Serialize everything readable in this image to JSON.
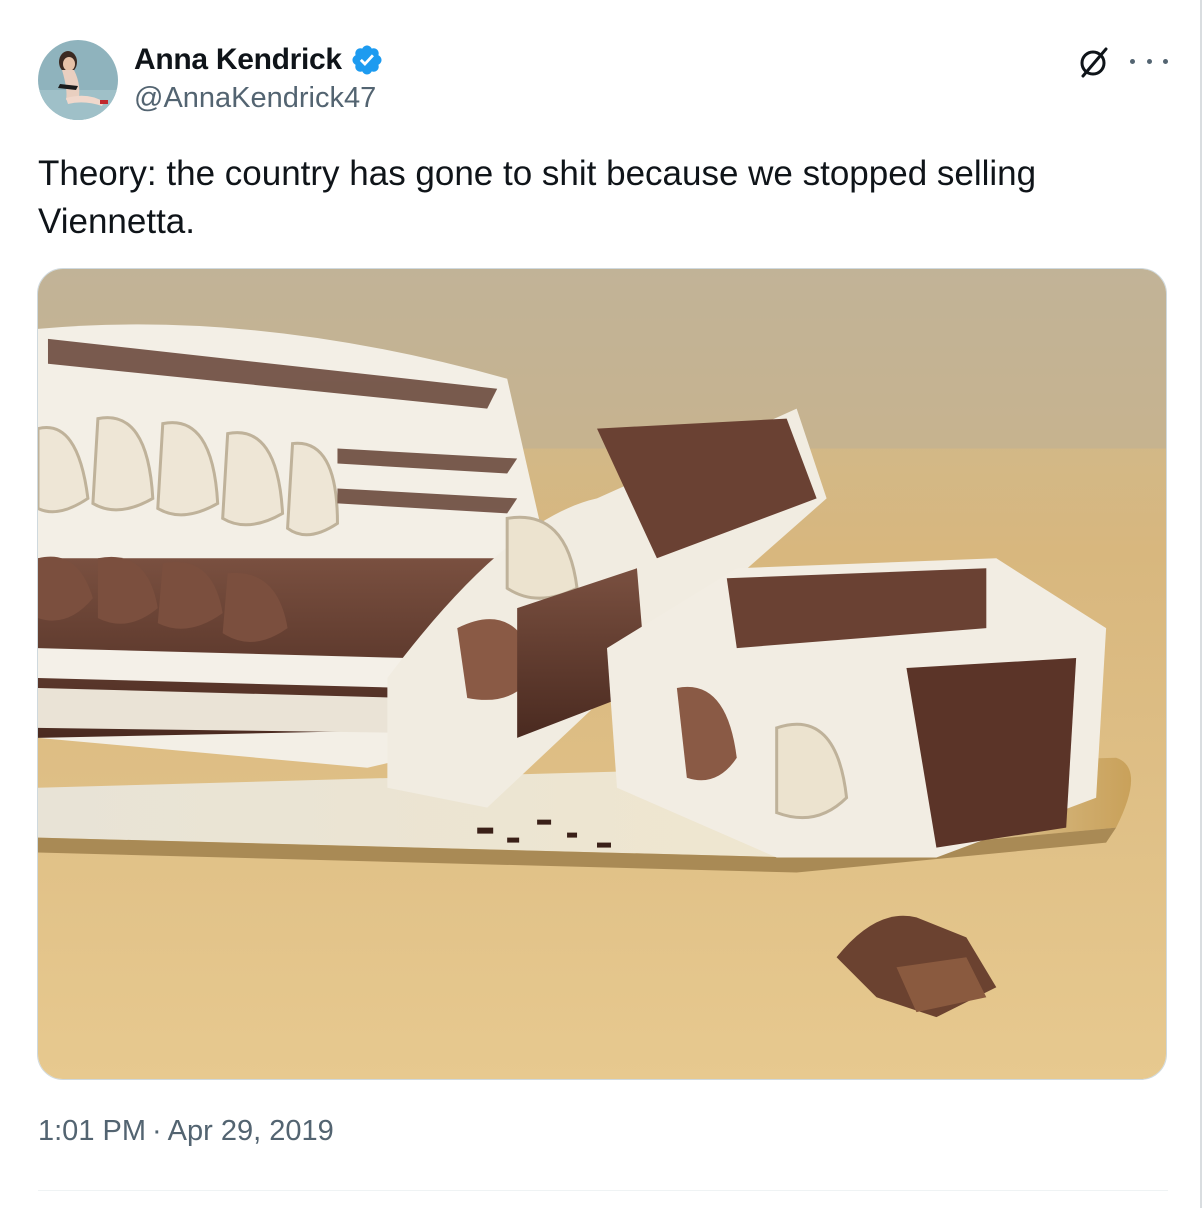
{
  "author": {
    "display_name": "Anna Kendrick",
    "handle": "@AnnaKendrick47",
    "verified": true,
    "verified_color": "#1d9bf0"
  },
  "tweet": {
    "text": "Theory: the country has gone to shit because we stopped selling Viennetta.",
    "time": "1:01 PM",
    "separator": "·",
    "date": "Apr 29, 2019"
  },
  "icons": {
    "verified": "verified-badge-icon",
    "grok": "grok-slash-icon",
    "more": "more-dots-icon"
  },
  "colors": {
    "text_primary": "#0f1419",
    "text_secondary": "#536471",
    "border": "#cfd9de"
  }
}
